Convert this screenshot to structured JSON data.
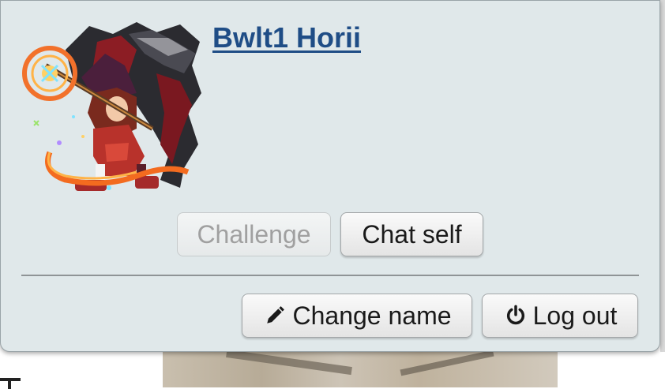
{
  "popup": {
    "username": "Bwlt1 Horii",
    "avatar": {
      "icon": "avatar-image",
      "alt": ""
    },
    "buttons": {
      "challenge": {
        "label": "Challenge",
        "disabled": true
      },
      "chat_self": {
        "label": "Chat self",
        "disabled": false
      },
      "change_name": {
        "label": "Change name",
        "icon": "pencil-icon"
      },
      "log_out": {
        "label": "Log out",
        "icon": "power-icon"
      }
    }
  },
  "colors": {
    "popup_background": "#e0e8ea",
    "username_link": "#1f4d86",
    "disabled_text": "#a0a0a0"
  }
}
